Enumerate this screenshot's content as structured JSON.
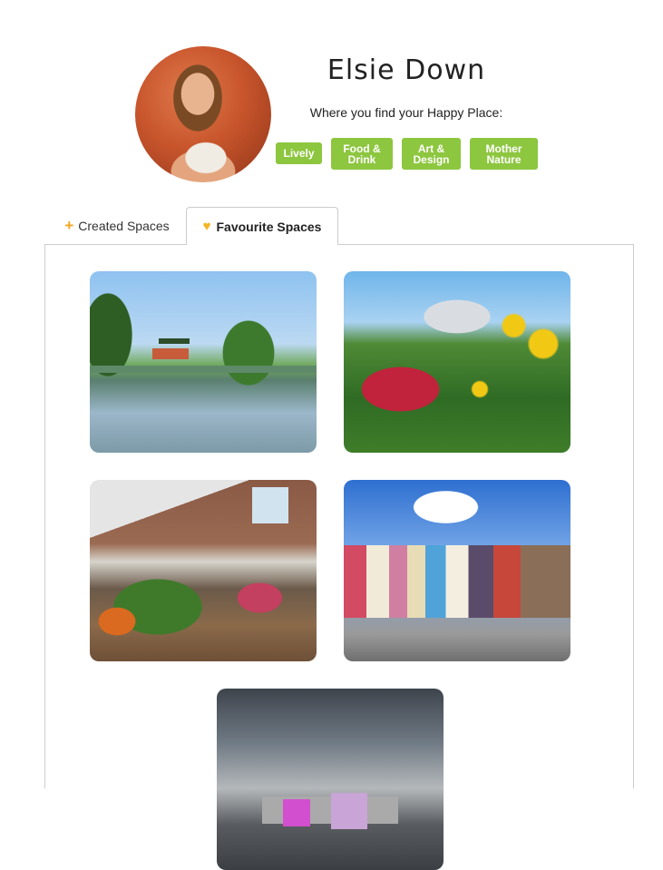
{
  "profile": {
    "name": "Elsie Down",
    "subtitle": "Where you find your Happy Place:",
    "tags": [
      "Lively",
      "Food & Drink",
      "Art & Design",
      "Mother Nature"
    ]
  },
  "tabs": {
    "created": {
      "label": "Created Spaces",
      "icon": "plus-icon"
    },
    "favourite": {
      "label": "Favourite Spaces",
      "icon": "heart-icon",
      "active": true
    }
  },
  "favourites": {
    "cards": [
      {
        "id": "pagoda-lake",
        "scene": "pagoda-lake"
      },
      {
        "id": "stadium-garden",
        "scene": "stadium-garden"
      },
      {
        "id": "market",
        "scene": "market"
      },
      {
        "id": "colorful-street",
        "scene": "colorful-street"
      },
      {
        "id": "concrete-building",
        "scene": "concrete-building"
      }
    ]
  },
  "colors": {
    "tag_green": "#8dc63f",
    "accent_orange": "#f5a623",
    "border": "#cccccc"
  }
}
